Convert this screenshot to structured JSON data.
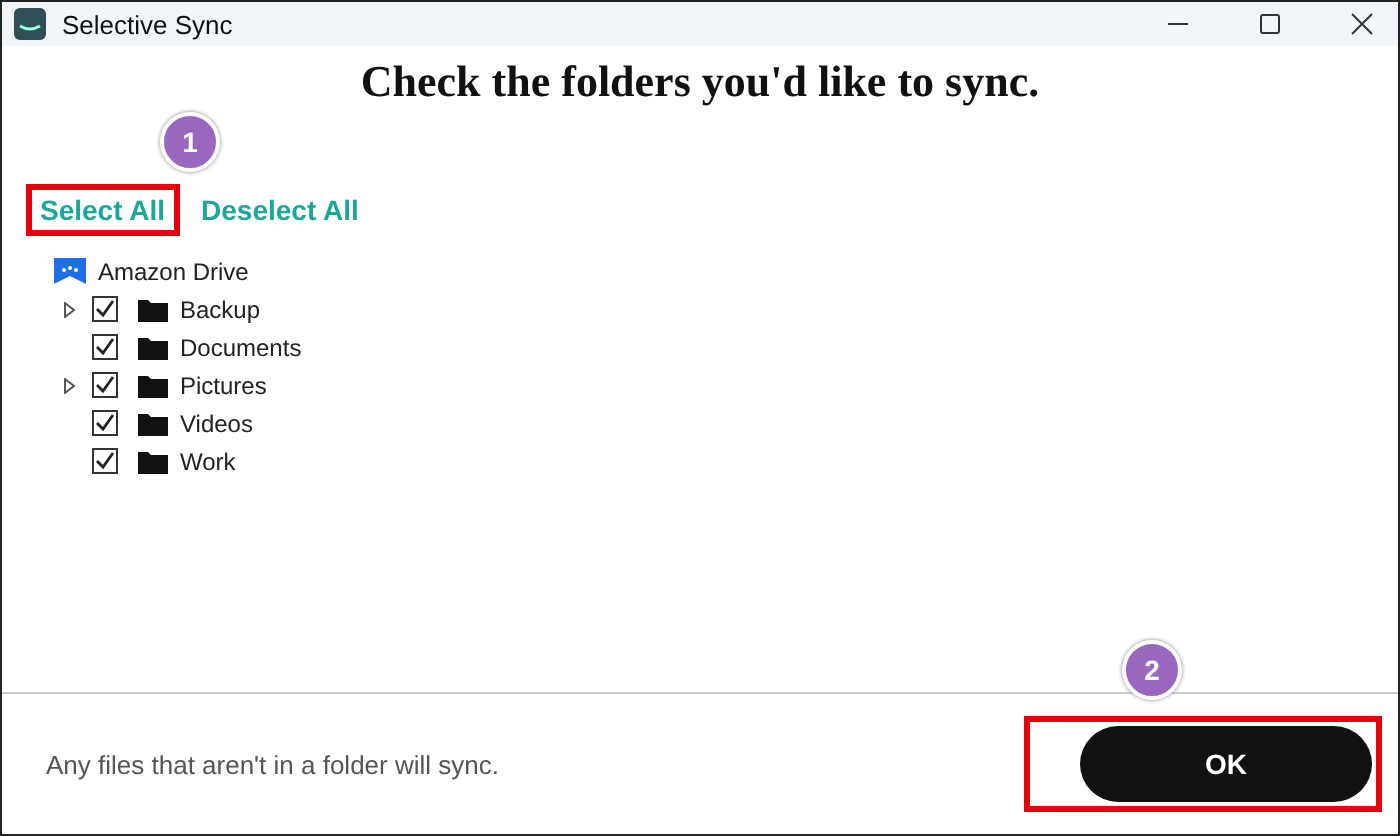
{
  "window": {
    "title": "Selective Sync"
  },
  "heading": "Check the folders you'd like to sync.",
  "actions": [
    {
      "label": "Select All",
      "highlighted": true,
      "badge": "1"
    },
    {
      "label": "Deselect All",
      "highlighted": false
    }
  ],
  "tree": {
    "label": "Amazon Drive",
    "children": [
      {
        "label": "Backup",
        "checked": true,
        "has_children": true
      },
      {
        "label": "Documents",
        "checked": true,
        "has_children": false
      },
      {
        "label": "Pictures",
        "checked": true,
        "has_children": true
      },
      {
        "label": "Videos",
        "checked": true,
        "has_children": false
      },
      {
        "label": "Work",
        "checked": true,
        "has_children": false
      }
    ]
  },
  "footer": {
    "note": "Any files that aren't in a folder will sync.",
    "button": {
      "label": "OK",
      "highlighted": true,
      "badge": "2"
    }
  }
}
